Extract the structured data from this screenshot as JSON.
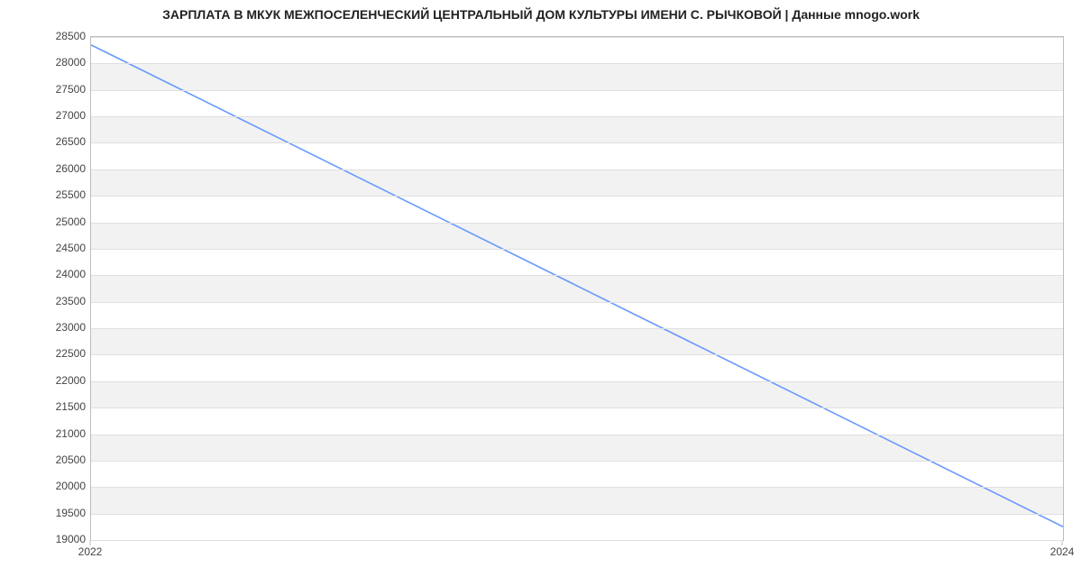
{
  "chart_data": {
    "type": "line",
    "title": "ЗАРПЛАТА В МКУК МЕЖПОСЕЛЕНЧЕСКИЙ ЦЕНТРАЛЬНЫЙ ДОМ КУЛЬТУРЫ ИМЕНИ С. РЫЧКОВОЙ | Данные mnogo.work",
    "x": [
      2022,
      2024
    ],
    "values": [
      28350,
      19250
    ],
    "xlabel": "",
    "ylabel": "",
    "xlim": [
      2022,
      2024
    ],
    "ylim": [
      19000,
      28500
    ],
    "x_ticks": [
      2022,
      2024
    ],
    "y_ticks": [
      19000,
      19500,
      20000,
      20500,
      21000,
      21500,
      22000,
      22500,
      23000,
      23500,
      24000,
      24500,
      25000,
      25500,
      26000,
      26500,
      27000,
      27500,
      28000,
      28500
    ],
    "line_color": "#6699ff"
  }
}
